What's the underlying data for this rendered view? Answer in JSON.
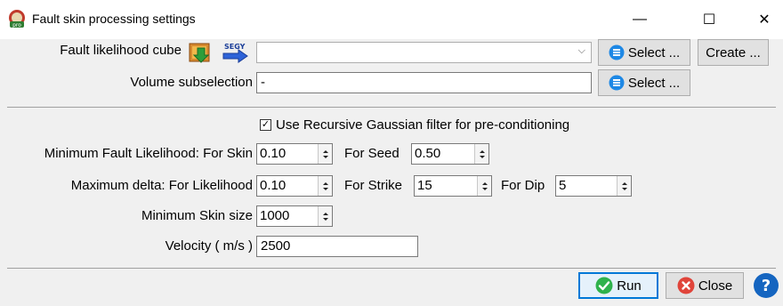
{
  "window": {
    "title": "Fault skin processing settings",
    "minimize_glyph": "—",
    "maximize_glyph": "☐",
    "close_glyph": "✕"
  },
  "input": {
    "fault_label": "Fault likelihood cube",
    "fault_value": "",
    "select_label": "Select ...",
    "create_label": "Create ...",
    "volume_label": "Volume subselection",
    "volume_value": "-",
    "volume_select_label": "Select ..."
  },
  "filter": {
    "checked": true,
    "label": "Use Recursive Gaussian filter for pre-conditioning"
  },
  "min_likelihood": {
    "label": "Minimum Fault Likelihood:  For Skin",
    "skin_value": "0.10",
    "seed_label": "For Seed",
    "seed_value": "0.50"
  },
  "max_delta": {
    "label": "Maximum delta:  For Likelihood",
    "likelihood_value": "0.10",
    "strike_label": "For Strike",
    "strike_value": "15",
    "dip_label": "For Dip",
    "dip_value": "5"
  },
  "skin_size": {
    "label": "Minimum Skin size",
    "value": "1000"
  },
  "velocity": {
    "label": "Velocity ( m/s )",
    "value": "2500"
  },
  "footer": {
    "run_label": "Run",
    "close_label": "Close",
    "help_glyph": "?"
  },
  "colors": {
    "accent_blue": "#0078d7",
    "run_green": "#2fb24c",
    "close_red": "#e0443a",
    "help_blue": "#1565c0"
  }
}
